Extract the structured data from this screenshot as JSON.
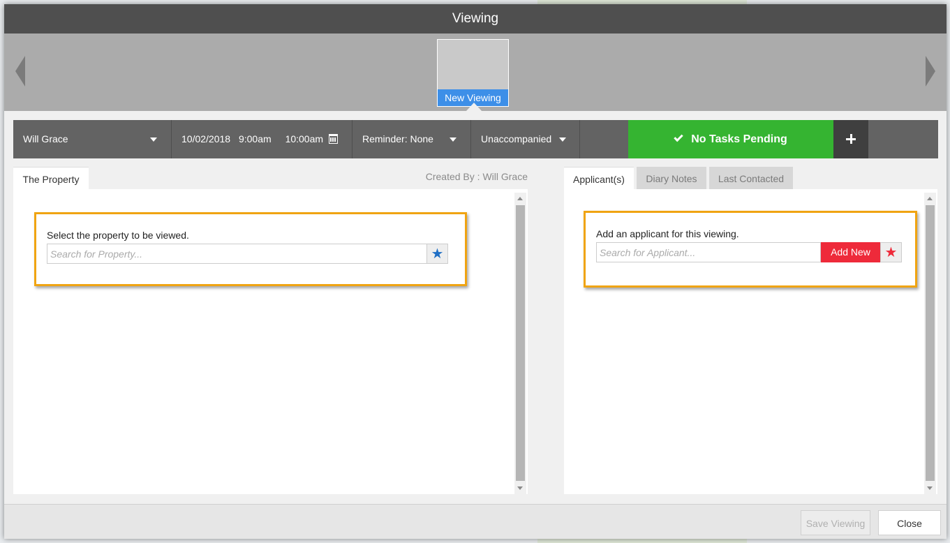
{
  "window": {
    "title": "Viewing"
  },
  "carousel": {
    "current_label": "New Viewing"
  },
  "toolbar": {
    "negotiator": "Will Grace",
    "date": "10/02/2018",
    "start_time": "9:00am",
    "end_time": "10:00am",
    "reminder": "Reminder: None",
    "accompaniment": "Unaccompanied",
    "tasks_status": "No Tasks Pending"
  },
  "left_panel": {
    "tab_label": "The Property",
    "created_by": "Created By : Will Grace",
    "prompt": "Select the property to be viewed.",
    "search_placeholder": "Search for Property..."
  },
  "right_panel": {
    "tabs": [
      {
        "label": "Applicant(s)"
      },
      {
        "label": "Diary Notes"
      },
      {
        "label": "Last Contacted"
      }
    ],
    "prompt": "Add an applicant for this viewing.",
    "search_placeholder": "Search for Applicant...",
    "add_new_label": "Add New"
  },
  "footer": {
    "save_label": "Save Viewing",
    "close_label": "Close"
  },
  "colors": {
    "accent_green": "#35b431",
    "accent_blue": "#3d8fe8",
    "accent_red": "#ee2a3a",
    "highlight": "#f0a412"
  }
}
